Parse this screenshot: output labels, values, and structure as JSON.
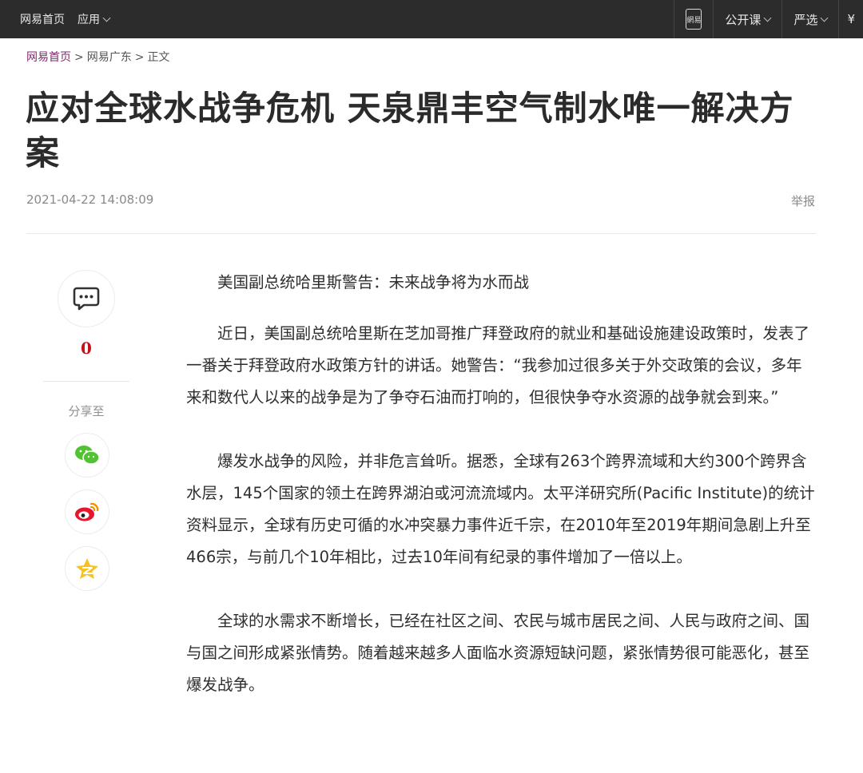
{
  "topbar": {
    "home": "网易首页",
    "apps": "应用",
    "phone_icon_text": "網易",
    "open_course": "公开课",
    "yanxuan": "严选",
    "yen": "¥"
  },
  "breadcrumb": {
    "home": "网易首页",
    "sep1": ">",
    "section": "网易广东",
    "sep2": ">",
    "current": "正文"
  },
  "article": {
    "title": "应对全球水战争危机 天泉鼎丰空气制水唯一解决方案",
    "datetime": "2021-04-22 14:08:09",
    "report": "举报",
    "paragraphs": [
      "美国副总统哈里斯警告：未来战争将为水而战",
      "近日，美国副总统哈里斯在芝加哥推广拜登政府的就业和基础设施建设政策时，发表了一番关于拜登政府水政策方针的讲话。她警告：“我参加过很多关于外交政策的会议，多年来和数代人以来的战争是为了争夺石油而打响的，但很快争夺水资源的战争就会到来。”",
      "爆发水战争的风险，并非危言耸听。据悉，全球有263个跨界流域和大约300个跨界含水层，145个国家的领土在跨界湖泊或河流流域内。太平洋研究所(Pacific Institute)的统计资料显示，全球有历史可循的水冲突暴力事件近千宗，在2010年至2019年期间急剧上升至466宗，与前几个10年相比，过去10年间有纪录的事件增加了一倍以上。",
      "全球的水需求不断增长，已经在社区之间、农民与城市居民之间、人民与政府之间、国与国之间形成紧张情势。随着越来越多人面临水资源短缺问题，紧张情势很可能恶化，甚至爆发战争。"
    ]
  },
  "share": {
    "comment_count": "0",
    "label": "分享至",
    "icons": [
      "wechat-icon",
      "weibo-icon",
      "qzone-icon"
    ]
  },
  "colors": {
    "topbar_bg": "#2c2c2c",
    "breadcrumb_home": "#7f2b6e",
    "comment_count": "#c4141a",
    "wechat": "#51c332",
    "weibo": "#e6162d",
    "qzone": "#f7c21d"
  }
}
